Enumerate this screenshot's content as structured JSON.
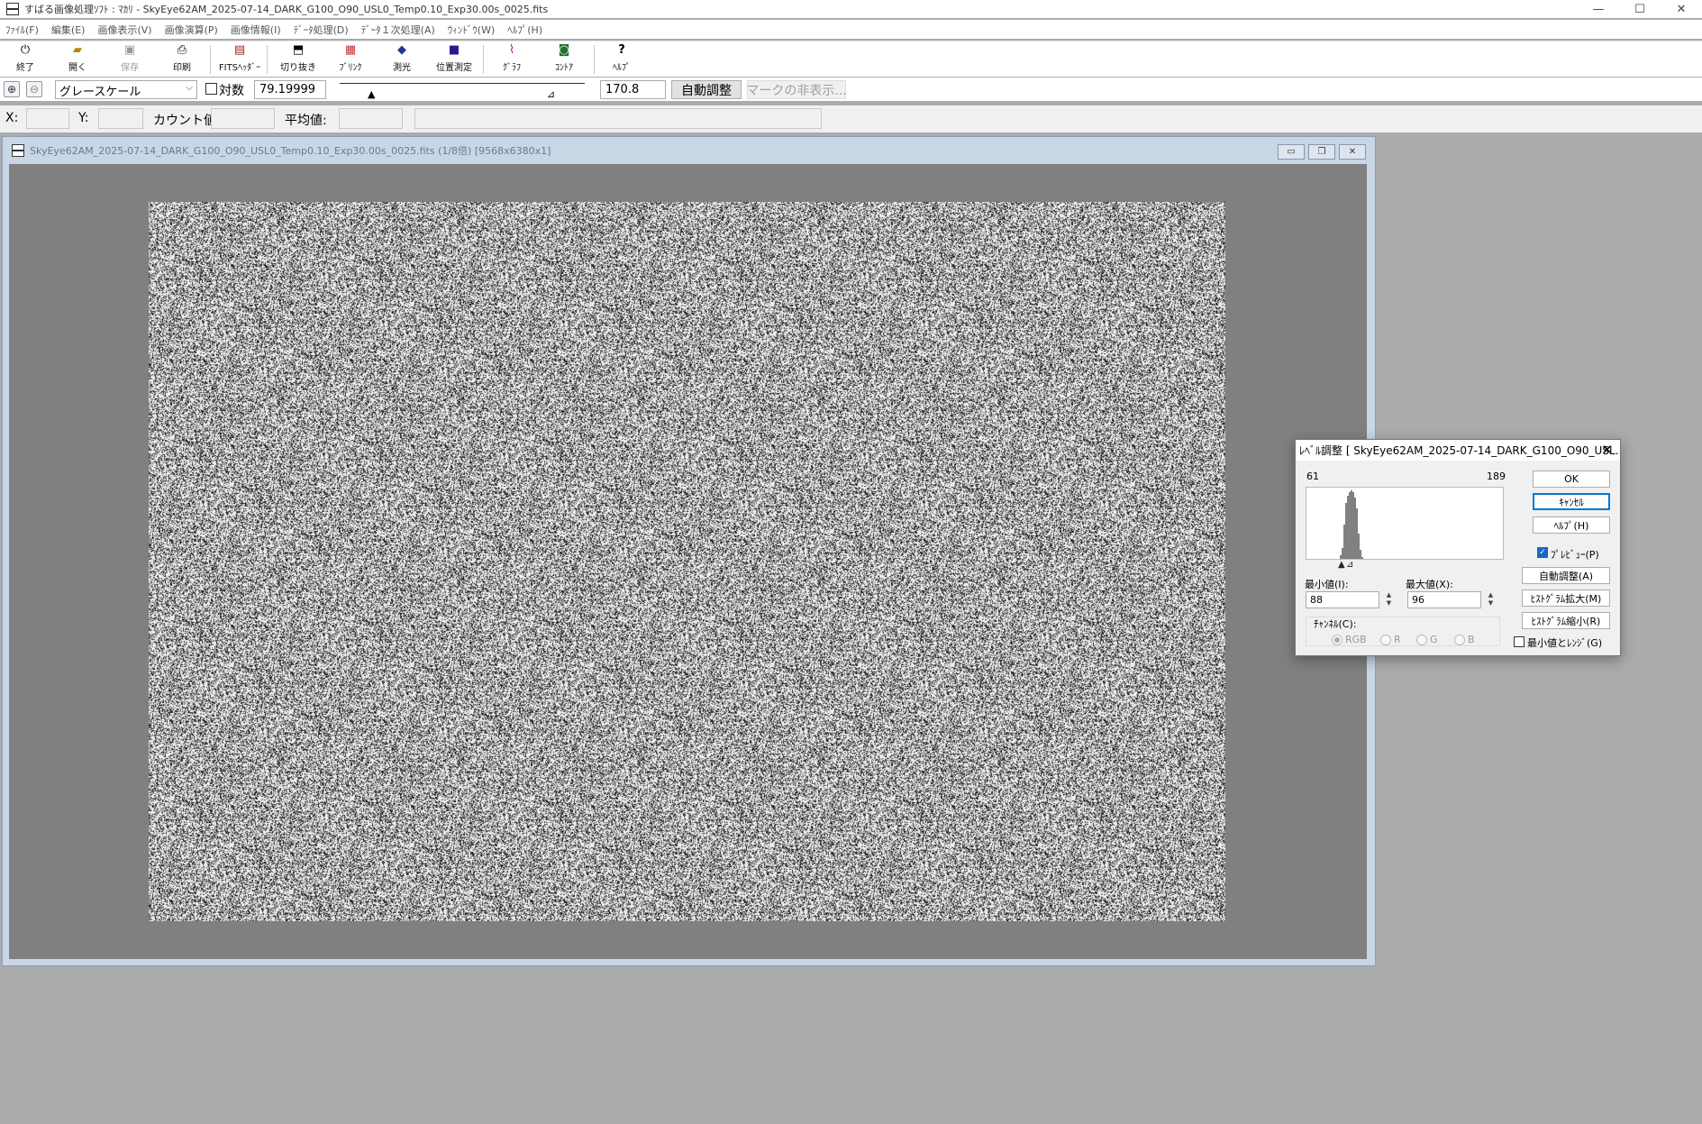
{
  "window": {
    "title": "すばる画像処理ｿﾌﾄ : ﾏｶﾘ - SkyEye62AM_2025-07-14_DARK_G100_O90_USL0_Temp0.10_Exp30.00s_0025.fits",
    "controls": [
      "—",
      "☐",
      "✕"
    ]
  },
  "menu": [
    "ﾌｧｲﾙ(F)",
    "編集(E)",
    "画像表示(V)",
    "画像演算(P)",
    "画像情報(I)",
    "ﾃﾞｰﾀ処理(D)",
    "ﾃﾞｰﾀ１次処理(A)",
    "ｳｨﾝﾄﾞｳ(W)",
    "ﾍﾙﾌﾟ(H)"
  ],
  "toolbar": {
    "exit": "終了",
    "open": "開く",
    "save": "保存",
    "print": "印刷",
    "fits_header": "FITSﾍｯﾀﾞｰ",
    "crop": "切り抜き",
    "blink": "ﾌﾞﾘﾝｸ",
    "photometry": "測光",
    "position": "位置測定",
    "graph": "ｸﾞﾗﾌ",
    "contour": "ｺﾝﾄｱ",
    "help": "ﾍﾙﾌﾟ"
  },
  "display": {
    "color_mode": "グレースケール",
    "log_label": "対数",
    "log_checked": false,
    "min_value": "79.19999",
    "max_value": "170.8",
    "auto_adjust": "自動調整",
    "hide_marks": "マークの非表示..."
  },
  "status": {
    "x_label": "X:",
    "y_label": "Y:",
    "count_label": "カウント値:",
    "mean_label": "平均値:",
    "x": "",
    "y": "",
    "count": "",
    "mean": "",
    "message": ""
  },
  "image_window": {
    "title": "SkyEye62AM_2025-07-14_DARK_G100_O90_USL0_Temp0.10_Exp30.00s_0025.fits (1/8倍) [9568x6380x1]",
    "controls": [
      "▭",
      "❐",
      "✕"
    ]
  },
  "level_dialog": {
    "title": "ﾚﾍﾞﾙ調整 [ SkyEye62AM_2025-07-14_DARK_G100_O90_USL...",
    "hist_min": "61",
    "hist_max": "189",
    "min_label": "最小値(I):",
    "max_label": "最大値(X):",
    "min_value": "88",
    "max_value": "96",
    "channel_label": "ﾁｬﾝﾈﾙ(C):",
    "channels": [
      "RGB",
      "R",
      "G",
      "B"
    ],
    "selected_channel": "RGB",
    "ok": "OK",
    "cancel": "ｷｬﾝｾﾙ",
    "help": "ﾍﾙﾌﾟ(H)",
    "preview": "ﾌﾟﾚﾋﾞｭｰ(P)",
    "preview_checked": true,
    "auto": "自動調整(A)",
    "hist_expand": "ﾋｽﾄｸﾞﾗﾑ拡大(M)",
    "hist_shrink": "ﾋｽﾄｸﾞﾗﾑ縮小(R)",
    "min_range": "最小値とﾚﾝｼﾞ(G)",
    "min_range_checked": false
  }
}
